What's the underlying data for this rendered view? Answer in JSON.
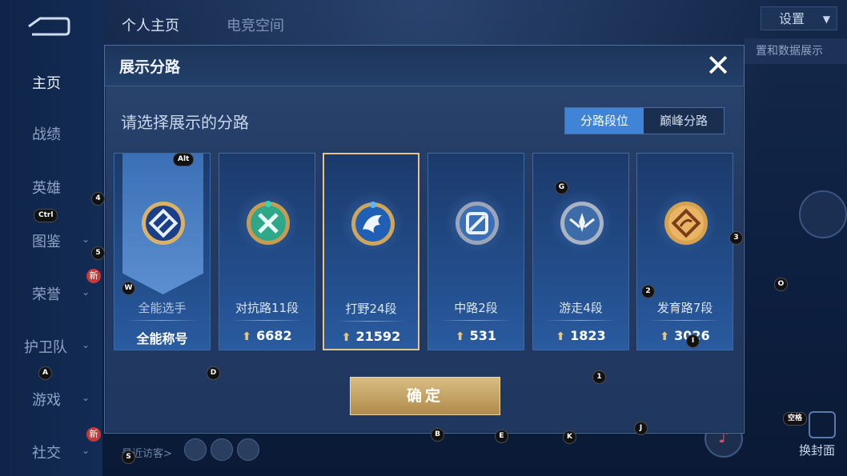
{
  "background": {
    "tabs": [
      {
        "label": "个人主页"
      },
      {
        "label": "电竞空间"
      }
    ],
    "settings_label": "设置",
    "settings_sub": "置和数据展示",
    "sidebar": [
      {
        "label": "主页"
      },
      {
        "label": "战绩"
      },
      {
        "label": "英雄"
      },
      {
        "label": "图鉴"
      },
      {
        "label": "荣誉"
      },
      {
        "label": "护卫队"
      },
      {
        "label": "游戏"
      },
      {
        "label": "社交"
      }
    ],
    "new_badge": "新",
    "visitors_label": "最近访客>",
    "change_cover_label": "换封面"
  },
  "modal": {
    "title": "展示分路",
    "subtitle": "请选择展示的分路",
    "toggle": [
      {
        "label": "分路段位",
        "active": true
      },
      {
        "label": "巅峰分路",
        "active": false
      }
    ],
    "cards": [
      {
        "name": "全能选手",
        "value": "全能称号",
        "icon": "all-round-icon",
        "selected": false
      },
      {
        "name": "对抗路11段",
        "value": "6682",
        "icon": "clash-lane-icon",
        "selected": false
      },
      {
        "name": "打野24段",
        "value": "21592",
        "icon": "jungle-icon",
        "selected": true
      },
      {
        "name": "中路2段",
        "value": "531",
        "icon": "mid-lane-icon",
        "selected": false
      },
      {
        "name": "游走4段",
        "value": "1823",
        "icon": "roam-icon",
        "selected": false
      },
      {
        "name": "发育路7段",
        "value": "3026",
        "icon": "farm-lane-icon",
        "selected": false
      }
    ],
    "confirm_label": "确定",
    "colors": {
      "accent": "#3f84d6",
      "gold": "#d9bd82",
      "selected_border": "#e6c489"
    }
  },
  "hints": {
    "alt": "Alt",
    "ctrl": "Ctrl",
    "space": "空格",
    "k4": "4",
    "k5": "5",
    "kW": "W",
    "kA": "A",
    "kD": "D",
    "kS": "S",
    "kG": "G",
    "k3": "3",
    "k2": "2",
    "kO": "O",
    "k1": "1",
    "kB": "B",
    "kE": "E",
    "kK": "K",
    "kJ": "J",
    "kI": "I"
  }
}
